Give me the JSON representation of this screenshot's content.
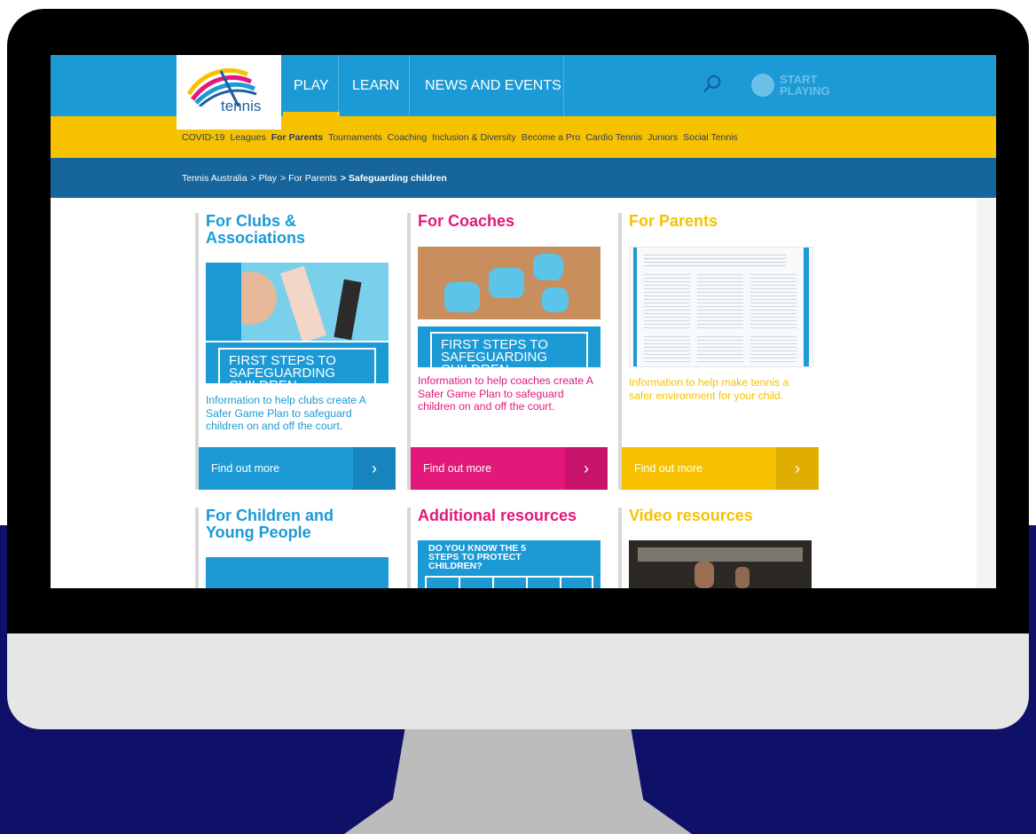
{
  "nav": {
    "logo_text": "tennis",
    "items": [
      {
        "label": "PLAY",
        "active": true
      },
      {
        "label": "LEARN",
        "active": false
      },
      {
        "label": "NEWS AND EVENTS",
        "active": false
      }
    ],
    "start_line1": "START",
    "start_line2": "PLAYING"
  },
  "subnav": {
    "items": [
      {
        "label": "COVID-19",
        "bold": false
      },
      {
        "label": "Leagues",
        "bold": false
      },
      {
        "label": "For Parents",
        "bold": true
      },
      {
        "label": "Tournaments",
        "bold": false
      },
      {
        "label": "Coaching",
        "bold": false
      },
      {
        "label": "Inclusion & Diversity",
        "bold": false
      },
      {
        "label": "Become a Pro",
        "bold": false
      },
      {
        "label": "Cardio Tennis",
        "bold": false
      },
      {
        "label": "Juniors",
        "bold": false
      },
      {
        "label": "Social Tennis",
        "bold": false
      }
    ]
  },
  "breadcrumb": {
    "items": [
      "Tennis Australia",
      "> Play",
      "> For Parents",
      "> Safeguarding children"
    ]
  },
  "cards": [
    {
      "title": "For Clubs & Associations",
      "banner": "FIRST STEPS TO SAFEGUARDING CHILDREN",
      "desc": "Information to help clubs create A Safer Game Plan to safeguard children on and off the court.",
      "button": "Find out more",
      "color": "#1b9ad6"
    },
    {
      "title": "For Coaches",
      "banner": "FIRST STEPS TO SAFEGUARDING CHILDREN",
      "desc": "Information to help coaches create A Safer Game Plan to safeguard children on and off the court.",
      "button": "Find out more",
      "color": "#e2187a"
    },
    {
      "title": "For Parents",
      "desc": "Information to help make tennis a safer environment for your child.",
      "button": "Find out more",
      "color": "#f6c200"
    },
    {
      "title": "For Children and Young People",
      "color": "#1b9ad6"
    },
    {
      "title": "Additional resources",
      "banner": "DO YOU KNOW THE 5 STEPS TO PROTECT CHILDREN?",
      "color": "#e2187a"
    },
    {
      "title": "Video resources",
      "color": "#f6c200"
    }
  ],
  "colors": {
    "blue": "#1b9ad6",
    "dark_blue": "#16659c",
    "yellow": "#f6c200",
    "pink": "#e2187a",
    "navy_background": "#0f1068"
  }
}
